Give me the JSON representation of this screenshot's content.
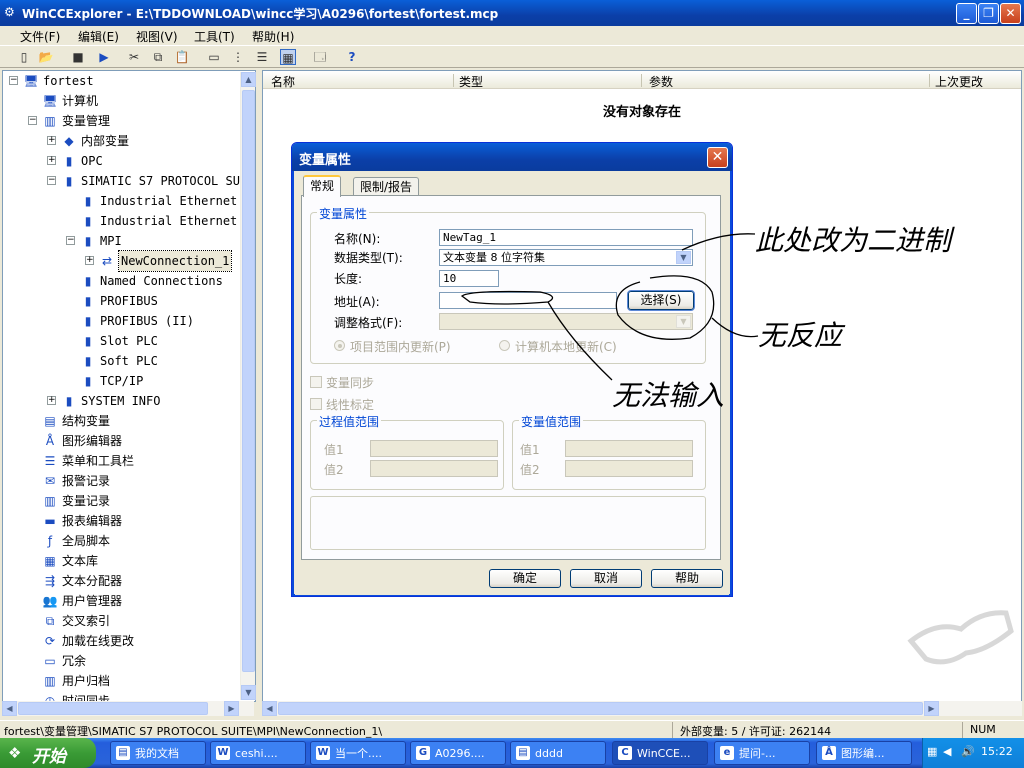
{
  "window": {
    "title": "WinCCExplorer - E:\\TDDOWNLOAD\\wincc学习\\A0296\\fortest\\fortest.mcp"
  },
  "menu": [
    "文件(F)",
    "编辑(E)",
    "视图(V)",
    "工具(T)",
    "帮助(H)"
  ],
  "tree": {
    "root": "fortest",
    "items": [
      {
        "label": "计算机",
        "icon": "computer-icon"
      },
      {
        "label": "变量管理",
        "icon": "tag-management-icon"
      },
      {
        "label": "内部变量",
        "icon": "internal-tags-icon"
      },
      {
        "label": "OPC",
        "icon": "driver-icon"
      },
      {
        "label": "SIMATIC S7 PROTOCOL SUITE",
        "icon": "driver-icon"
      },
      {
        "label": "Industrial Ethernet",
        "icon": "channel-unit-icon"
      },
      {
        "label": "Industrial Ethernet (I",
        "icon": "channel-unit-icon"
      },
      {
        "label": "MPI",
        "icon": "channel-unit-icon"
      },
      {
        "label": "NewConnection_1",
        "icon": "connection-icon"
      },
      {
        "label": "Named Connections",
        "icon": "channel-unit-icon"
      },
      {
        "label": "PROFIBUS",
        "icon": "channel-unit-icon"
      },
      {
        "label": "PROFIBUS (II)",
        "icon": "channel-unit-icon"
      },
      {
        "label": "Slot PLC",
        "icon": "channel-unit-icon"
      },
      {
        "label": "Soft PLC",
        "icon": "channel-unit-icon"
      },
      {
        "label": "TCP/IP",
        "icon": "channel-unit-icon"
      },
      {
        "label": "SYSTEM INFO",
        "icon": "driver-icon"
      },
      {
        "label": "结构变量",
        "icon": "struct-icon"
      },
      {
        "label": "图形编辑器",
        "icon": "graphics-icon"
      },
      {
        "label": "菜单和工具栏",
        "icon": "menu-icon"
      },
      {
        "label": "报警记录",
        "icon": "alarm-icon"
      },
      {
        "label": "变量记录",
        "icon": "tag-log-icon"
      },
      {
        "label": "报表编辑器",
        "icon": "report-icon"
      },
      {
        "label": "全局脚本",
        "icon": "script-icon"
      },
      {
        "label": "文本库",
        "icon": "textlib-icon"
      },
      {
        "label": "文本分配器",
        "icon": "distributor-icon"
      },
      {
        "label": "用户管理器",
        "icon": "user-icon"
      },
      {
        "label": "交叉索引",
        "icon": "crossref-icon"
      },
      {
        "label": "加载在线更改",
        "icon": "load-icon"
      },
      {
        "label": "冗余",
        "icon": "redundancy-icon"
      },
      {
        "label": "用户归档",
        "icon": "archive-icon"
      },
      {
        "label": "时间同步",
        "icon": "time-icon"
      }
    ]
  },
  "list": {
    "columns": [
      "名称",
      "类型",
      "参数",
      "上次更改"
    ],
    "empty_message": "没有对象存在"
  },
  "dialog": {
    "title": "变量属性",
    "tabs": [
      "常规",
      "限制/报告"
    ],
    "group_tag": "变量属性",
    "name_label": "名称(N):",
    "name_value": "NewTag_1",
    "datatype_label": "数据类型(T):",
    "datatype_value": "文本变量 8 位字符集",
    "length_label": "长度:",
    "length_value": "10",
    "address_label": "地址(A):",
    "address_value": "",
    "select_button": "选择(S)",
    "format_label": "调整格式(F):",
    "format_value": "",
    "radio_project": "项目范围内更新(P)",
    "radio_computer": "计算机本地更新(C)",
    "chk_sync": "变量同步",
    "chk_linear": "线性标定",
    "group_process": "过程值范围",
    "group_tagrange": "变量值范围",
    "value1": "值1",
    "value2": "值2",
    "ok": "确定",
    "cancel": "取消",
    "help": "帮助"
  },
  "annotations": {
    "note1": "此处改为二进制",
    "note2": "无反应",
    "note3": "无法输入"
  },
  "status": {
    "path": "fortest\\变量管理\\SIMATIC S7 PROTOCOL SUITE\\MPI\\NewConnection_1\\",
    "license": "外部变量: 5 / 许可证: 262144",
    "num": "NUM"
  },
  "taskbar": {
    "start": "开始",
    "tasks": [
      {
        "label": "我的文档",
        "icon": "folder-icon"
      },
      {
        "label": "ceshi....",
        "icon": "word-icon"
      },
      {
        "label": "当一个....",
        "icon": "word-icon"
      },
      {
        "label": "A0296....",
        "icon": "app-icon"
      },
      {
        "label": "dddd",
        "icon": "folder-icon"
      },
      {
        "label": "WinCCE...",
        "icon": "wincc-icon"
      },
      {
        "label": "提问-...",
        "icon": "browser-icon"
      },
      {
        "label": "图形编...",
        "icon": "graphics-icon"
      }
    ],
    "clock": "15:22"
  }
}
